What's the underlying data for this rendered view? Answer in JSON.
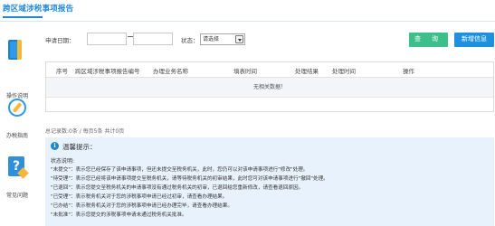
{
  "page": {
    "title": "跨区域涉税事项报告"
  },
  "sidebar": {
    "items": [
      {
        "label": "操作说明",
        "icon": "manual-book-icon"
      },
      {
        "label": "办税指南",
        "icon": "compass-icon"
      },
      {
        "label": "常见问题",
        "icon": "question-icon"
      }
    ]
  },
  "filters": {
    "date_label": "申请日期：",
    "date_from": "",
    "date_to": "",
    "status_label": "状态：",
    "status_selected": "请选择",
    "query_button": "查 询",
    "add_button": "新增信息"
  },
  "table": {
    "headers": [
      "序号",
      "跨区域涉税事项报告编号",
      "办理业务名称",
      "填表时间",
      "处理结果",
      "处理时间",
      "操作"
    ],
    "empty_text": "无相关数据！"
  },
  "pager": {
    "text": "总记录数:0条 / 每页5条 共计0页"
  },
  "tips": {
    "title": "温馨提示：",
    "subtitle": "状态说明:",
    "lines": [
      "\"未提交\"：表示您已经保存了该申请事项，但还未提交至税务机关，此时，您仍可以对该申请事项进行\"修改\"处理。",
      "\"待受理\"：表示您已经将该申请事项提交至税务机关，请等待税务机关的初审结果，此时您可对该申请事项进行\"撤回\"处理。",
      "\"已退回\"：表示您提交至税务机关的申请事项没有通过税务机关的初审，已退回给您重新修改，请查看退回原因。",
      "\"已受理\"：表示税务机关对于您的涉税事项申请已经过初审，请查看办理结果。",
      "\"已办结\"：表示税务机关对于您的涉税事项申请已经办理完毕，请查看办理结果。",
      "\"未批准\"：表示您提交的涉税事项申请未通过税务机关批准。"
    ]
  }
}
